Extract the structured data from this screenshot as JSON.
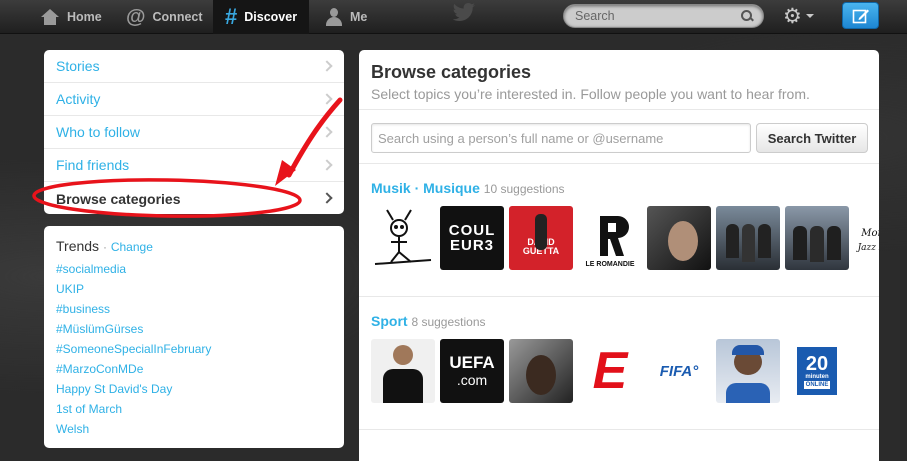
{
  "topnav": {
    "home": "Home",
    "connect": "Connect",
    "discover": "Discover",
    "me": "Me",
    "search_placeholder": "Search"
  },
  "sidebar": {
    "items": [
      {
        "label": "Stories"
      },
      {
        "label": "Activity"
      },
      {
        "label": "Who to follow"
      },
      {
        "label": "Find friends"
      },
      {
        "label": "Browse categories",
        "selected": true
      }
    ]
  },
  "trends": {
    "title": "Trends",
    "separator": "·",
    "change": "Change",
    "items": [
      "#socialmedia",
      "UKIP",
      "#business",
      "#MüslümGürses",
      "#SomeoneSpecialInFebruary",
      "#MarzoConMDe",
      "Happy St David's Day",
      "1st of March",
      "Welsh"
    ]
  },
  "main": {
    "title": "Browse categories",
    "subtitle": "Select topics you’re interested in. Follow people you want to hear from.",
    "search_placeholder": "Search using a person’s full name or @username",
    "search_button": "Search Twitter",
    "categories": [
      {
        "name": "Musik · Musique",
        "count": "10 suggestions",
        "thumbs": [
          "cartoon",
          "COULEUR3",
          "DAVID GUETTA",
          "LE ROMANDIE",
          "portrait-woman",
          "band-photo",
          "band-photo-2",
          "Montreux Jazz Festival"
        ]
      },
      {
        "name": "Sport",
        "count": "8 suggestions",
        "thumbs": [
          "football-player",
          "UEFA.com",
          "portrait-man",
          "L'Equipe E",
          "FIFA",
          "athlete-cap",
          "20 minuten ONLINE"
        ]
      }
    ]
  },
  "colors": {
    "link": "#2fb1e6",
    "annotation": "#e8131b",
    "compose": "#2b96dd"
  }
}
